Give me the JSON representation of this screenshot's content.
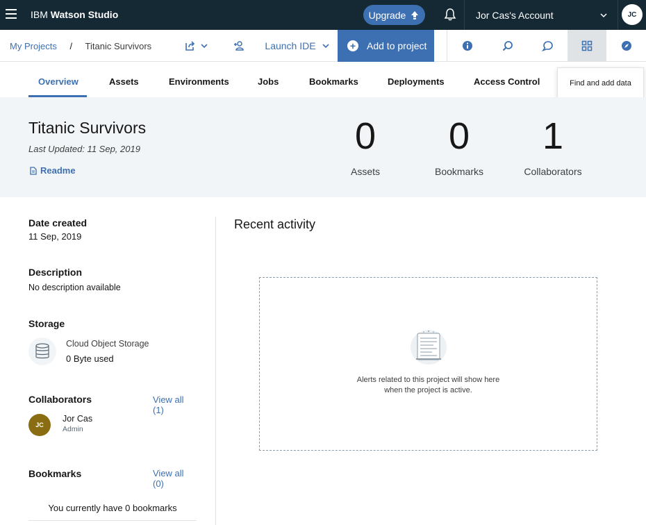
{
  "topbar": {
    "brand_prefix": "IBM",
    "brand_name": "Watson Studio",
    "upgrade_label": "Upgrade",
    "account_label": "Jor Cas's Account",
    "avatar_initials": "JC"
  },
  "breadcrumb": {
    "root": "My Projects",
    "separator": "/",
    "current": "Titanic Survivors"
  },
  "toolbar": {
    "launch_ide": "Launch IDE",
    "add_to_project": "Add to project",
    "tooltip": "Find and add data"
  },
  "tabs": [
    {
      "label": "Overview",
      "active": true
    },
    {
      "label": "Assets"
    },
    {
      "label": "Environments"
    },
    {
      "label": "Jobs"
    },
    {
      "label": "Bookmarks"
    },
    {
      "label": "Deployments"
    },
    {
      "label": "Access Control"
    }
  ],
  "project": {
    "title": "Titanic Survivors",
    "last_updated": "Last Updated:  11 Sep, 2019",
    "readme": "Readme"
  },
  "stats": [
    {
      "value": "0",
      "label": "Assets"
    },
    {
      "value": "0",
      "label": "Bookmarks"
    },
    {
      "value": "1",
      "label": "Collaborators"
    }
  ],
  "details": {
    "date_created_label": "Date created",
    "date_created": "11 Sep, 2019",
    "description_label": "Description",
    "description": "No description available",
    "storage_label": "Storage",
    "storage_name": "Cloud Object Storage",
    "storage_used": "0 Byte used",
    "collaborators_label": "Collaborators",
    "collaborators_view_all": "View all (1)",
    "collaborator_initials": "JC",
    "collaborator_name": "Jor Cas",
    "collaborator_role": "Admin",
    "bookmarks_label": "Bookmarks",
    "bookmarks_view_all": "View all (0)",
    "bookmarks_empty": "You currently have 0 bookmarks"
  },
  "activity": {
    "title": "Recent activity",
    "empty_line1": "Alerts related to this project will show here",
    "empty_line2": "when the project is active."
  },
  "colors": {
    "topbar": "#152935",
    "accent": "#3d70b2",
    "hero_bg": "#f2f5f8",
    "avatar_user": "#8a6d12"
  },
  "icons": [
    "menu-icon",
    "upgrade-arrow-icon",
    "bell-icon",
    "chevron-down-icon",
    "export-icon",
    "add-collaborator-icon",
    "plus-icon",
    "info-icon",
    "search-icon",
    "chat-icon",
    "find-data-icon",
    "compass-icon",
    "document-icon",
    "database-icon",
    "empty-activity-icon"
  ]
}
